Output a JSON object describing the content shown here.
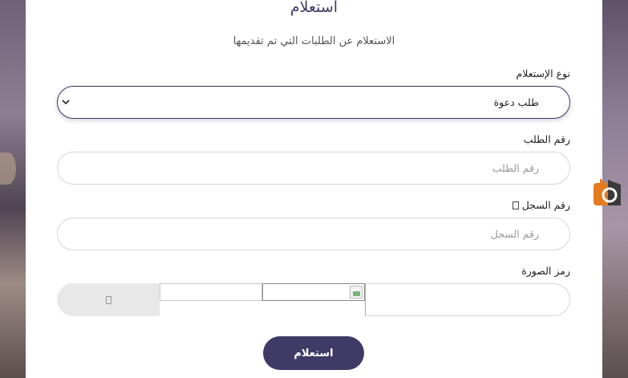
{
  "form": {
    "title": "استعلام",
    "subtitle": "الاستعلام عن الطلبات التي تم تقديمها",
    "inquiry_type": {
      "label": "نوع الإستعلام",
      "value": "طلب دعوة"
    },
    "request_number": {
      "label": "رقم الطلب",
      "placeholder": "رقم الطلب"
    },
    "record_number": {
      "label": "رقم السجل",
      "placeholder": "رقم السجل"
    },
    "captcha": {
      "label": "رمز الصورة"
    },
    "submit_label": "استعلام"
  },
  "colors": {
    "accent": "#3f3a66",
    "field_border": "#d6d6d6",
    "refresh_bg": "#e8e8e8"
  },
  "icons": {
    "select_arrow": "chevron-down-icon",
    "record_info": "info-icon",
    "refresh": "refresh-icon",
    "widget": "floating-widget-icon"
  }
}
